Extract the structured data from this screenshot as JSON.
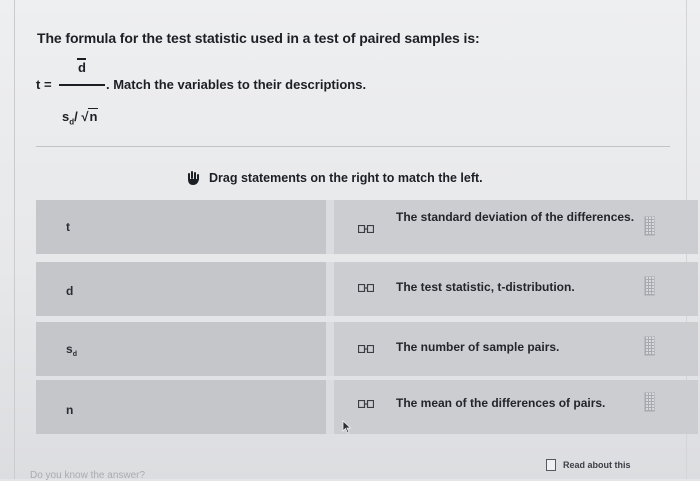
{
  "question": "The formula for the test statistic used in a test of paired samples is:",
  "formula": {
    "t_equals": "t =",
    "numerator": "d",
    "instruction": ". Match the variables to their descriptions.",
    "denominator_s": "s",
    "denominator_sub": "d",
    "denominator_sep": "/ √",
    "denominator_n": "n"
  },
  "hint": "Drag statements on the right to match the left.",
  "rows": [
    {
      "variable": "t",
      "statement": "The standard deviation of the differences."
    },
    {
      "variable": "d",
      "statement": "The test statistic, t-distribution."
    },
    {
      "variable": "s",
      "variable_sub": "d",
      "statement": "The number of sample pairs."
    },
    {
      "variable": "n",
      "statement": "The mean of the differences of pairs."
    }
  ],
  "read_about": "Read about this",
  "bottom_partial": "Do you know the answer?"
}
